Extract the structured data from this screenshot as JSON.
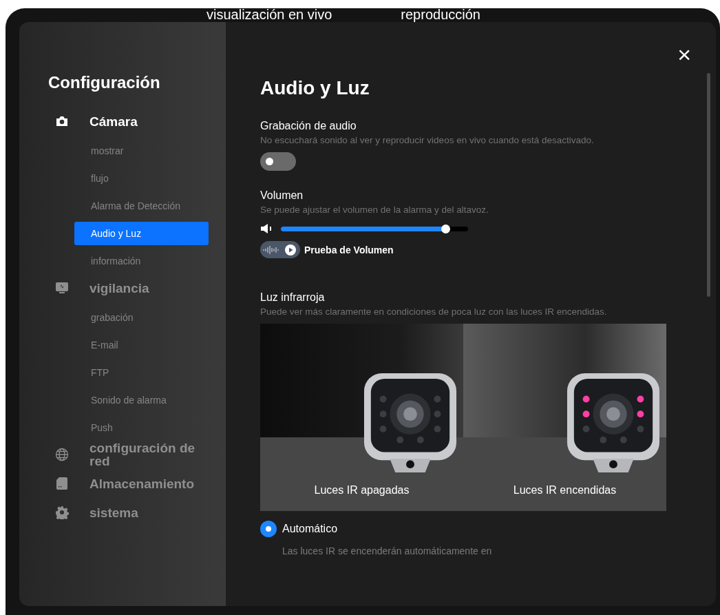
{
  "tabs": [
    {
      "label": "visualización en vivo"
    },
    {
      "label": "reproducción"
    }
  ],
  "sidebar": {
    "title": "Configuración",
    "groups": [
      {
        "label": "Cámara",
        "active": true,
        "children": [
          {
            "label": "mostrar",
            "selected": false
          },
          {
            "label": "flujo",
            "selected": false
          },
          {
            "label": "Alarma de Detección",
            "selected": false
          },
          {
            "label": "Audio y Luz",
            "selected": true
          },
          {
            "label": "información",
            "selected": false
          }
        ]
      },
      {
        "label": "vigilancia",
        "active": false,
        "children": [
          {
            "label": "grabación",
            "selected": false
          },
          {
            "label": "E-mail",
            "selected": false
          },
          {
            "label": "FTP",
            "selected": false
          },
          {
            "label": "Sonido de alarma",
            "selected": false
          },
          {
            "label": "Push",
            "selected": false
          }
        ]
      },
      {
        "label": "configuración de red",
        "active": false
      },
      {
        "label": "Almacenamiento",
        "active": false
      },
      {
        "label": "sistema",
        "active": false
      }
    ]
  },
  "content": {
    "title": "Audio y Luz",
    "close": "×",
    "audio_recording": {
      "title": "Grabación de audio",
      "description": "No escuchará sonido al ver y reproducir videos en vivo cuando está desactivado.",
      "on": false
    },
    "volume": {
      "title": "Volumen",
      "description": "Se puede ajustar el volumen de la alarma y del altavoz.",
      "level": 0.88,
      "test_label": "Prueba de Volumen"
    },
    "infrared": {
      "title": "Luz infrarroja",
      "description": "Puede ver más claramente en condiciones de poca luz con las luces IR encendidas.",
      "images": [
        {
          "label": "Luces IR apagadas",
          "ir_on": false
        },
        {
          "label": "Luces IR encendidas",
          "ir_on": true
        }
      ],
      "options": [
        {
          "label": "Automático",
          "description": "Las luces IR se encenderán automáticamente en",
          "selected": true
        }
      ]
    }
  }
}
